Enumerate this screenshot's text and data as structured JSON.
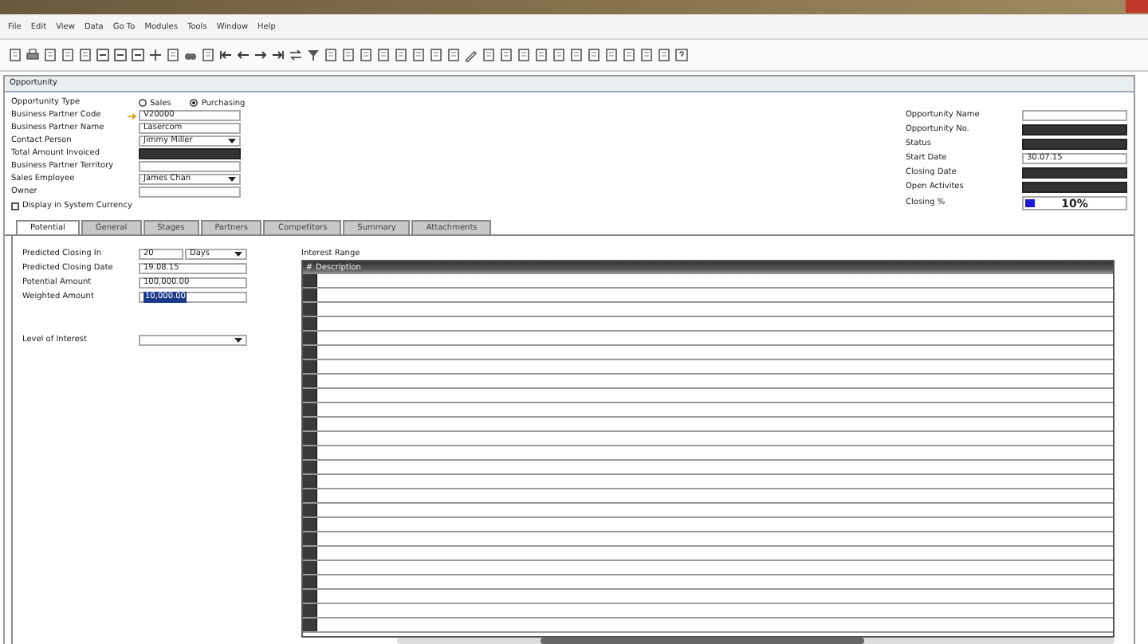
{
  "menu": [
    "File",
    "Edit",
    "View",
    "Data",
    "Go To",
    "Modules",
    "Tools",
    "Window",
    "Help"
  ],
  "window": {
    "title": "Opportunity"
  },
  "opportunity_type": {
    "label": "Opportunity Type",
    "options": [
      {
        "label": "Sales",
        "selected": false
      },
      {
        "label": "Purchasing",
        "selected": true
      }
    ]
  },
  "left_fields": [
    {
      "label": "Business Partner Code",
      "value": "V20000",
      "kind": "link"
    },
    {
      "label": "Business Partner Name",
      "value": "Lasercom",
      "kind": "text"
    },
    {
      "label": "Contact Person",
      "value": "Jimmy Miller",
      "kind": "dropdown"
    },
    {
      "label": "Total Amount Invoiced",
      "kind": "dark"
    },
    {
      "label": "Business Partner Territory",
      "kind": "text"
    },
    {
      "label": "Sales Employee",
      "value": "James Chan",
      "kind": "dropdown"
    },
    {
      "label": "Owner",
      "kind": "text"
    }
  ],
  "display_in_system_currency": {
    "label": "Display in System Currency",
    "checked": false
  },
  "right_fields": [
    {
      "label": "Opportunity Name",
      "kind": "text"
    },
    {
      "label": "Opportunity No.",
      "kind": "dark"
    },
    {
      "label": "Status",
      "kind": "dark"
    },
    {
      "label": "Start Date",
      "value": "30.07.15",
      "kind": "text"
    },
    {
      "label": "Closing Date",
      "kind": "dark"
    },
    {
      "label": "Open Activites",
      "kind": "dark"
    },
    {
      "label": "Closing %",
      "kind": "meter",
      "level": 0.1,
      "reading": "10%"
    }
  ],
  "tabs": [
    {
      "label": "Potential",
      "selected": true
    },
    {
      "label": "General",
      "selected": false
    },
    {
      "label": "Stages",
      "selected": false
    },
    {
      "label": "Partners",
      "selected": false
    },
    {
      "label": "Competitors",
      "selected": false
    },
    {
      "label": "Summary",
      "selected": false
    },
    {
      "label": "Attachments",
      "selected": false
    }
  ],
  "potential": {
    "closing_in": {
      "label": "Predicted Closing In",
      "value": "20",
      "unit": "Days"
    },
    "fields": [
      {
        "label": "Predicted Closing Date",
        "value": "19.08.15",
        "selected": false
      },
      {
        "label": "Potential Amount",
        "value": "100,000.00",
        "selected": false
      },
      {
        "label": "Weighted Amount",
        "value": "10,000.00",
        "selected": true
      }
    ],
    "level_of_interest": {
      "label": "Level of Interest"
    }
  },
  "interest_range": {
    "title": "Interest Range",
    "columns": [
      "#",
      "Description"
    ]
  }
}
